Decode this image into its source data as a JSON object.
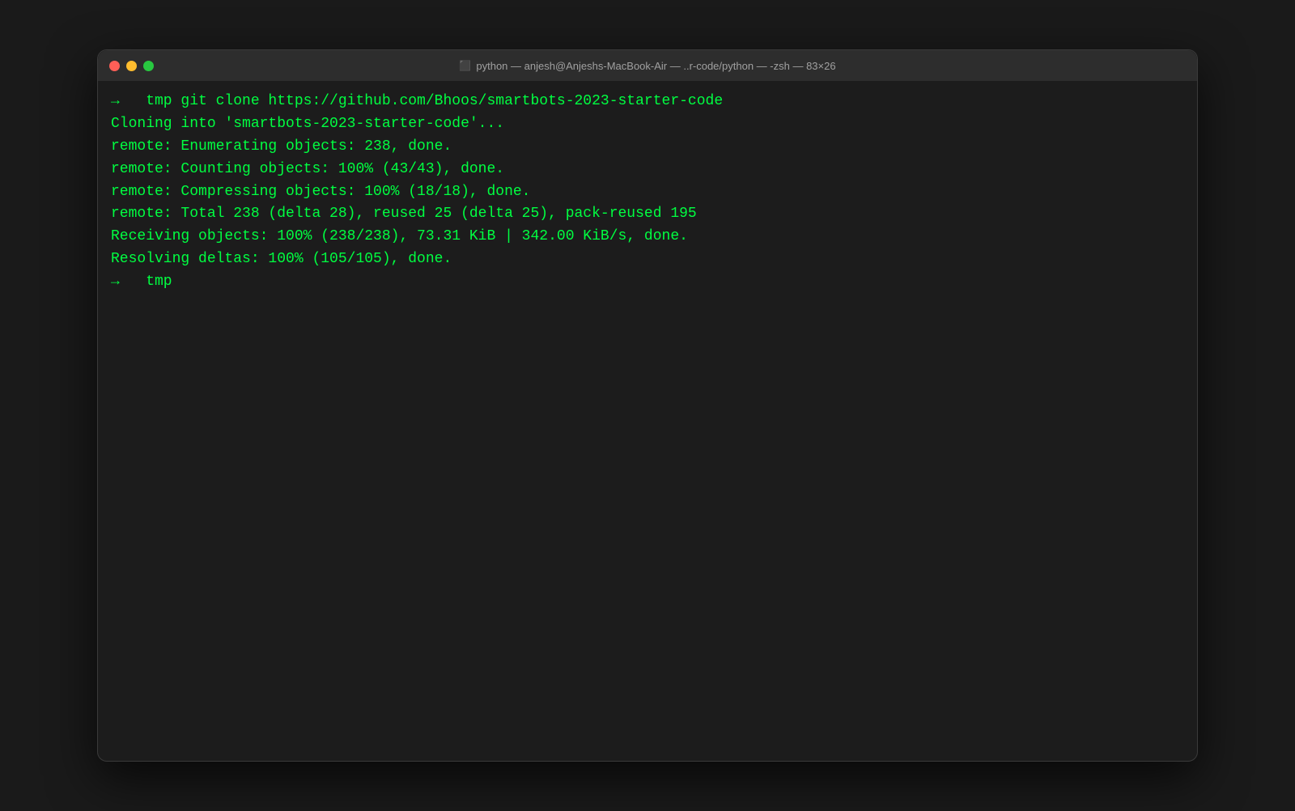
{
  "window": {
    "titlebar_text": "python — anjesh@Anjeshs-MacBook-Air — ..r-code/python — -zsh — 83×26",
    "controls": {
      "close_label": "close",
      "minimize_label": "minimize",
      "maximize_label": "maximize"
    }
  },
  "terminal": {
    "lines": [
      {
        "type": "prompt",
        "content": "→   tmp git clone https://github.com/Bhoos/smartbots-2023-starter-code"
      },
      {
        "type": "output",
        "content": "Cloning into 'smartbots-2023-starter-code'..."
      },
      {
        "type": "output",
        "content": "remote: Enumerating objects: 238, done."
      },
      {
        "type": "output",
        "content": "remote: Counting objects: 100% (43/43), done."
      },
      {
        "type": "output",
        "content": "remote: Compressing objects: 100% (18/18), done."
      },
      {
        "type": "output",
        "content": "remote: Total 238 (delta 28), reused 25 (delta 25), pack-reused 195"
      },
      {
        "type": "output",
        "content": "Receiving objects: 100% (238/238), 73.31 KiB | 342.00 KiB/s, done."
      },
      {
        "type": "output",
        "content": "Resolving deltas: 100% (105/105), done."
      },
      {
        "type": "prompt",
        "content": "→   tmp"
      }
    ],
    "colors": {
      "text": "#00ff41",
      "background": "#1c1c1c"
    }
  }
}
